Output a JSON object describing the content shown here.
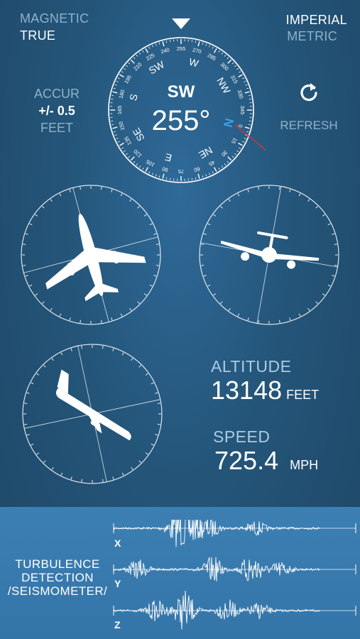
{
  "north_mode": {
    "magnetic": "MAGNETIC",
    "true": "TRUE",
    "selected": "TRUE"
  },
  "units": {
    "imperial": "IMPERIAL",
    "metric": "METRIC",
    "selected": "IMPERIAL"
  },
  "accuracy": {
    "label": "ACCUR",
    "value": "+/- 0.5",
    "unit": "FEET"
  },
  "refresh": {
    "label": "REFRESH"
  },
  "compass": {
    "direction": "SW",
    "heading": "255°",
    "heading_value": 255,
    "degree_ticks": [
      "0",
      "15",
      "30",
      "45",
      "60",
      "75",
      "90",
      "105",
      "120",
      "135",
      "150",
      "165",
      "180",
      "195",
      "210",
      "225",
      "240",
      "255",
      "270",
      "285",
      "300",
      "315",
      "330",
      "345"
    ],
    "cardinals": [
      "N",
      "NE",
      "E",
      "SE",
      "S",
      "SW",
      "W",
      "NW"
    ]
  },
  "attitude": {
    "pitch_deg": -15,
    "roll_deg": 10,
    "yaw_deg": -12
  },
  "altitude": {
    "label": "ALTITUDE",
    "value": "13148",
    "unit": "FEET"
  },
  "speed": {
    "label": "SPEED",
    "value": "725.4",
    "unit": "MPH"
  },
  "seismometer": {
    "title_lines": [
      "TURBULENCE",
      "DETECTION",
      "/SEISMOMETER/"
    ],
    "axes": [
      "X",
      "Y",
      "Z"
    ]
  },
  "colors": {
    "north_marker": "#3aa0e8",
    "south_marker": "#d8323a",
    "background": "#245579",
    "panel": "#3a7db1"
  }
}
